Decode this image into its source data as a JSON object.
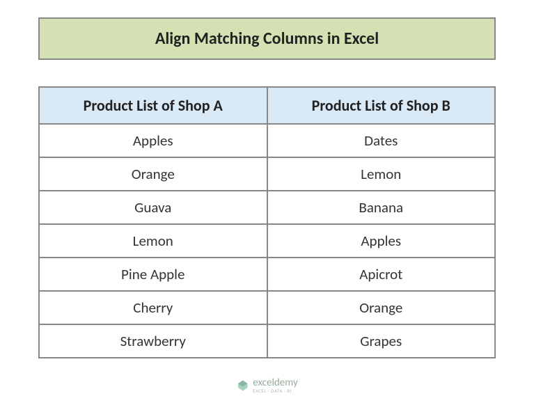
{
  "title": "Align Matching Columns in Excel",
  "headers": {
    "colA": "Product List of Shop A",
    "colB": "Product List of Shop B"
  },
  "rows": [
    {
      "a": "Apples",
      "b": "Dates"
    },
    {
      "a": "Orange",
      "b": "Lemon"
    },
    {
      "a": "Guava",
      "b": "Banana"
    },
    {
      "a": "Lemon",
      "b": "Apples"
    },
    {
      "a": "Pine Apple",
      "b": "Apicrot"
    },
    {
      "a": "Cherry",
      "b": "Orange"
    },
    {
      "a": "Strawberry",
      "b": "Grapes"
    }
  ],
  "watermark": {
    "brand": "exceldemy",
    "tagline": "EXCEL · DATA · BI"
  }
}
